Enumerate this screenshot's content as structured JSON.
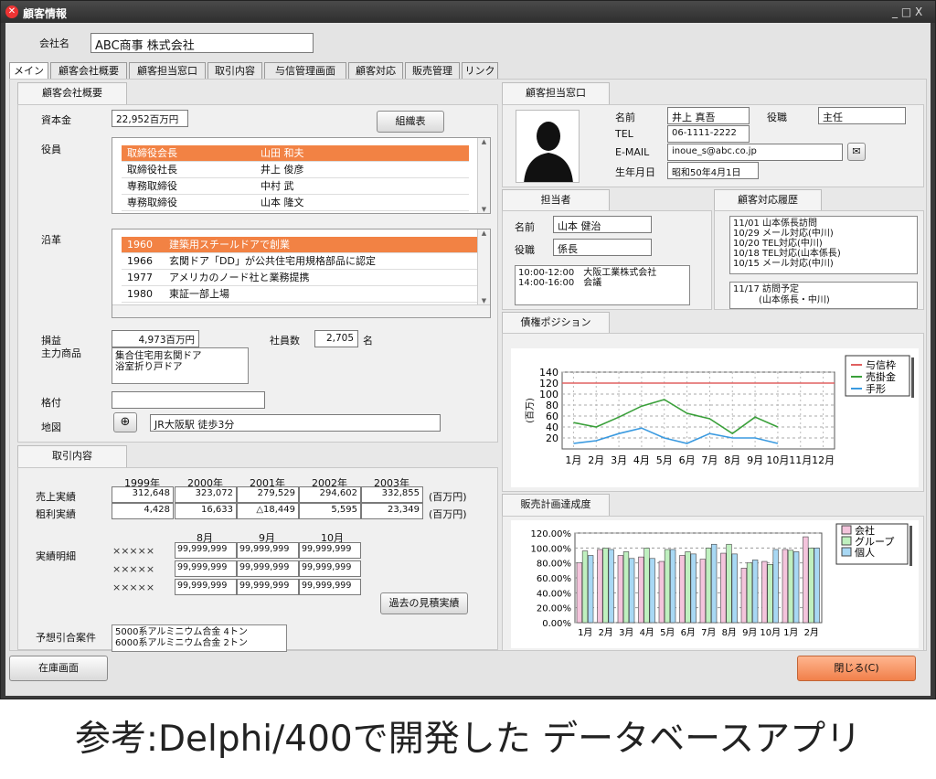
{
  "window": {
    "title": "顧客情報",
    "controls": "_ □ X"
  },
  "company": {
    "label": "会社名",
    "value": "ABC商事 株式会社"
  },
  "tabs": [
    "メイン",
    "顧客会社概要",
    "顧客担当窓口",
    "取引内容",
    "与信管理画面",
    "顧客対応",
    "販売管理",
    "リンク"
  ],
  "overview": {
    "header": "顧客会社概要",
    "capital_label": "資本金",
    "capital_value": "22,952百万円",
    "org_button": "組織表",
    "officers_label": "役員",
    "officers": [
      [
        "取締役会長",
        "山田 和夫"
      ],
      [
        "取締役社長",
        "井上 俊彦"
      ],
      [
        "専務取締役",
        "中村 武"
      ],
      [
        "専務取締役",
        "山本 隆文"
      ]
    ],
    "history_label": "沿革",
    "history": [
      [
        "1960",
        "建築用スチールドアで創業"
      ],
      [
        "1966",
        "玄関ドア「DD」が公共住宅用規格部品に認定"
      ],
      [
        "1977",
        "アメリカのノード社と業務提携"
      ],
      [
        "1980",
        "東証一部上場"
      ]
    ],
    "profit_label": "損益",
    "profit_value": "4,973百万円",
    "employees_label": "社員数",
    "employees_value": "2,705",
    "employees_unit": "名",
    "products_label": "主力商品",
    "products": [
      "集合住宅用玄関ドア",
      "浴室折り戸ドア"
    ],
    "rating_label": "格付",
    "rating_value": "",
    "map_label": "地図",
    "map_value": "JR大阪駅 徒歩3分"
  },
  "trade": {
    "header": "取引内容",
    "years": [
      "1999年",
      "2000年",
      "2001年",
      "2002年",
      "2003年"
    ],
    "sales_label": "売上実績",
    "sales": [
      "312,648",
      "323,072",
      "279,529",
      "294,602",
      "332,855"
    ],
    "gross_label": "粗利実績",
    "gross": [
      "4,428",
      "16,633",
      "△18,449",
      "5,595",
      "23,349"
    ],
    "unit": "(百万円)",
    "detail_label": "実績明細",
    "months": [
      "8月",
      "9月",
      "10月"
    ],
    "detail_rows": [
      [
        "×××××",
        "99,999,999",
        "99,999,999",
        "99,999,999"
      ],
      [
        "×××××",
        "99,999,999",
        "99,999,999",
        "99,999,999"
      ],
      [
        "×××××",
        "99,999,999",
        "99,999,999",
        "99,999,999"
      ]
    ],
    "past_button": "過去の見積実績",
    "forecast_label": "予想引合案件",
    "forecast": [
      "5000系アルミニウム合金 4トン",
      "6000系アルミニウム合金 2トン"
    ]
  },
  "contact": {
    "header": "顧客担当窓口",
    "name_label": "名前",
    "name_value": "井上 真吾",
    "role_label": "役職",
    "role_value": "主任",
    "tel_label": "TEL",
    "tel_value": "06-1111-2222",
    "mail_label": "E-MAIL",
    "mail_value": "inoue_s@abc.co.jp",
    "birth_label": "生年月日",
    "birth_value": "昭和50年4月1日"
  },
  "rep": {
    "header": "担当者",
    "name_label": "名前",
    "name_value": "山本 健治",
    "role_label": "役職",
    "role_value": "係長",
    "schedule": [
      "10:00-12:00　大阪工業株式会社",
      "14:00-16:00　会議"
    ]
  },
  "history_log": {
    "header": "顧客対応履歴",
    "entries": [
      "11/01 山本係長訪問",
      "10/29 メール対応(中川)",
      "10/20 TEL対応(中川)",
      "10/18 TEL対応(山本係長)",
      "10/15 メール対応(中川)"
    ],
    "plan": [
      "11/17 訪問予定",
      "(山本係長・中川)"
    ]
  },
  "chart_credit": {
    "header": "債権ポジション",
    "ylabel": "(百万)",
    "legend": [
      "与信枠",
      "売掛金",
      "手形"
    ],
    "colors": [
      "#e06060",
      "#3aa03a",
      "#3a9ae0"
    ]
  },
  "chart_sales": {
    "header": "販売計画達成度",
    "legend": [
      "会社",
      "グループ",
      "個人"
    ],
    "colors": [
      "#f4c4dc",
      "#bff0bf",
      "#a8d8f4"
    ]
  },
  "chart_data": [
    {
      "type": "line",
      "categories": [
        "1月",
        "2月",
        "3月",
        "4月",
        "5月",
        "6月",
        "7月",
        "8月",
        "9月",
        "10月",
        "11月",
        "12月"
      ],
      "ylabel": "(百万)",
      "ylim": [
        0,
        140
      ],
      "yticks": [
        20,
        40,
        60,
        80,
        100,
        120,
        140
      ],
      "grid": true,
      "legend_position": "right",
      "series": [
        {
          "name": "与信枠",
          "values": [
            120,
            120,
            120,
            120,
            120,
            120,
            120,
            120,
            120,
            120,
            120,
            120
          ]
        },
        {
          "name": "売掛金",
          "values": [
            48,
            40,
            58,
            78,
            90,
            65,
            55,
            28,
            58,
            40,
            null,
            null
          ]
        },
        {
          "name": "手形",
          "values": [
            10,
            15,
            28,
            38,
            20,
            10,
            28,
            20,
            20,
            10,
            null,
            null
          ]
        }
      ]
    },
    {
      "type": "bar",
      "categories": [
        "1月",
        "2月",
        "3月",
        "4月",
        "5月",
        "6月",
        "7月",
        "8月",
        "9月",
        "10月",
        "1月",
        "2月"
      ],
      "ylim": [
        0,
        120
      ],
      "yticks": [
        "0.00%",
        "20.00%",
        "40.00%",
        "60.00%",
        "80.00%",
        "100.00%",
        "120.00%"
      ],
      "grid": true,
      "legend_position": "right",
      "series": [
        {
          "name": "会社",
          "values": [
            80,
            98,
            90,
            88,
            82,
            90,
            85,
            93,
            73,
            82,
            98,
            115
          ]
        },
        {
          "name": "グループ",
          "values": [
            96,
            100,
            95,
            100,
            98,
            95,
            100,
            105,
            80,
            78,
            97,
            100
          ]
        },
        {
          "name": "個人",
          "values": [
            90,
            98,
            86,
            86,
            98,
            92,
            105,
            92,
            84,
            98,
            95,
            100
          ]
        }
      ]
    }
  ],
  "footer": {
    "stock_button": "在庫画面",
    "close_button": "閉じる(C)"
  },
  "caption": "参考:Delphi/400で開発した データベースアプリ"
}
